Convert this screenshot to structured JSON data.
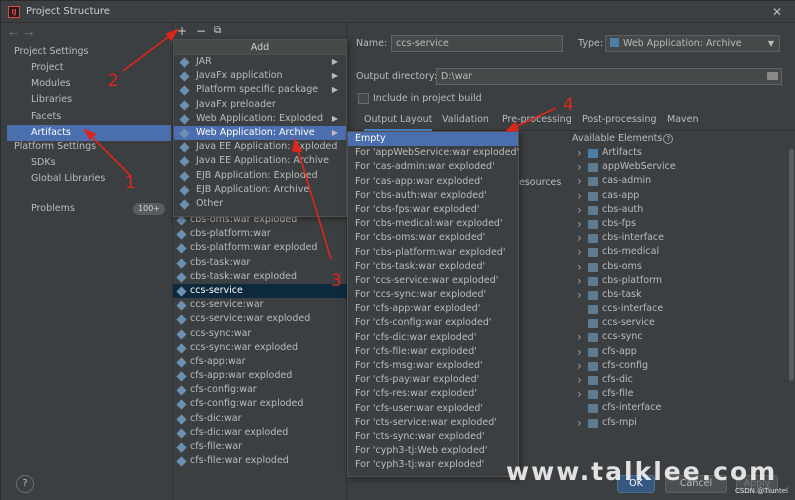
{
  "window": {
    "title": "Project Structure",
    "app_icon": "intellij-icon",
    "close_glyph": "✕"
  },
  "nav": {
    "back_glyph": "←",
    "forward_glyph": "→",
    "project_settings_label": "Project Settings",
    "project_settings_items": [
      "Project",
      "Modules",
      "Libraries",
      "Facets",
      "Artifacts"
    ],
    "platform_settings_label": "Platform Settings",
    "platform_settings_items": [
      "SDKs",
      "Global Libraries"
    ],
    "problems_label": "Problems",
    "problems_count": "100+",
    "selected": "Artifacts"
  },
  "toolbar": {
    "add_glyph": "+",
    "remove_glyph": "−",
    "copy_glyph": "⧉"
  },
  "add_menu": {
    "header": "Add",
    "items": [
      {
        "label": "JAR",
        "submenu": true
      },
      {
        "label": "JavaFx application",
        "submenu": true
      },
      {
        "label": "Platform specific package",
        "submenu": true
      },
      {
        "label": "JavaFx preloader",
        "submenu": false
      },
      {
        "label": "Web Application: Exploded",
        "submenu": true
      },
      {
        "label": "Web Application: Archive",
        "submenu": true,
        "selected": true
      },
      {
        "label": "Java EE Application: Exploded",
        "submenu": false
      },
      {
        "label": "Java EE Application: Archive",
        "submenu": false
      },
      {
        "label": "EJB Application: Exploded",
        "submenu": false
      },
      {
        "label": "EJB Application: Archive",
        "submenu": false
      },
      {
        "label": "Other",
        "submenu": false
      }
    ]
  },
  "artifacts": {
    "items": [
      "cbs-oms:war exploded",
      "cbs-platform:war",
      "cbs-platform:war exploded",
      "cbs-task:war",
      "cbs-task:war exploded",
      "ccs-service",
      "ccs-service:war",
      "ccs-service:war exploded",
      "ccs-sync:war",
      "ccs-sync:war exploded",
      "cfs-app:war",
      "cfs-app:war exploded",
      "cfs-config:war",
      "cfs-config:war exploded",
      "cfs-dic:war",
      "cfs-dic:war exploded",
      "cfs-file:war",
      "cfs-file:war exploded"
    ],
    "selected": "ccs-service"
  },
  "detail": {
    "name_label": "Name:",
    "name_value": "ccs-service",
    "type_label": "Type:",
    "type_value": "Web Application: Archive",
    "output_dir_label": "Output directory:",
    "output_dir_value": "D:\\war",
    "include_label": "Include in project build",
    "tabs": [
      "Output Layout",
      "Validation",
      "Pre-processing",
      "Post-processing",
      "Maven"
    ],
    "active_tab": "Output Layout",
    "available_label": "Available Elements",
    "hidden_fragment": "esources"
  },
  "submenu": {
    "items": [
      "Empty",
      "For 'appWebService:war exploded'",
      "For 'cas-admin:war exploded'",
      "For 'cas-app:war exploded'",
      "For 'cbs-auth:war exploded'",
      "For 'cbs-fps:war exploded'",
      "For 'cbs-medical:war exploded'",
      "For 'cbs-oms:war exploded'",
      "For 'cbs-platform:war exploded'",
      "For 'cbs-task:war exploded'",
      "For 'ccs-service:war exploded'",
      "For 'ccs-sync:war exploded'",
      "For 'cfs-app:war exploded'",
      "For 'cfs-config:war exploded'",
      "For 'cfs-dic:war exploded'",
      "For 'cfs-file:war exploded'",
      "For 'cfs-msg:war exploded'",
      "For 'cfs-pay:war exploded'",
      "For 'cfs-res:war exploded'",
      "For 'cfs-user:war exploded'",
      "For 'cts-service:war exploded'",
      "For 'cts-sync:war exploded'",
      "For 'cyph3-tj:Web exploded'",
      "For 'cyph3-tj:war exploded'"
    ],
    "selected": "Empty"
  },
  "available_elements": [
    {
      "label": "Artifacts",
      "expandable": true,
      "icon": "artifacts-icon"
    },
    {
      "label": "appWebService",
      "expandable": true,
      "icon": "module-folder-icon"
    },
    {
      "label": "cas-admin",
      "expandable": true,
      "icon": "module-folder-icon"
    },
    {
      "label": "cas-app",
      "expandable": true,
      "icon": "module-folder-icon"
    },
    {
      "label": "cbs-auth",
      "expandable": true,
      "icon": "module-folder-icon"
    },
    {
      "label": "cbs-fps",
      "expandable": true,
      "icon": "module-folder-icon"
    },
    {
      "label": "cbs-interface",
      "expandable": true,
      "icon": "module-folder-icon"
    },
    {
      "label": "cbs-medical",
      "expandable": true,
      "icon": "module-folder-icon"
    },
    {
      "label": "cbs-oms",
      "expandable": true,
      "icon": "module-folder-icon"
    },
    {
      "label": "cbs-platform",
      "expandable": true,
      "icon": "module-folder-icon"
    },
    {
      "label": "cbs-task",
      "expandable": true,
      "icon": "module-folder-icon"
    },
    {
      "label": "ccs-interface",
      "expandable": false,
      "icon": "module-folder-icon"
    },
    {
      "label": "ccs-service",
      "expandable": false,
      "icon": "module-folder-icon"
    },
    {
      "label": "ccs-sync",
      "expandable": true,
      "icon": "module-folder-icon"
    },
    {
      "label": "cfs-app",
      "expandable": true,
      "icon": "module-folder-icon"
    },
    {
      "label": "cfs-config",
      "expandable": true,
      "icon": "module-folder-icon"
    },
    {
      "label": "cfs-dic",
      "expandable": true,
      "icon": "module-folder-icon"
    },
    {
      "label": "cfs-file",
      "expandable": true,
      "icon": "module-folder-icon"
    },
    {
      "label": "cfs-interface",
      "expandable": false,
      "icon": "module-folder-icon"
    },
    {
      "label": "cfs-mpi",
      "expandable": true,
      "icon": "module-folder-icon"
    }
  ],
  "buttons": {
    "help_glyph": "?",
    "ok": "OK",
    "cancel": "Cancel",
    "apply": "Apply"
  },
  "annotations": {
    "numbers": [
      "1",
      "2",
      "3",
      "4"
    ],
    "color": "#e0251b"
  },
  "watermark": "www.talklee.com",
  "credit": "CSDN @Tiuntel",
  "colors": {
    "selection": "#4b6eaf",
    "background": "#3c3f41",
    "annotation": "#e0251b"
  }
}
